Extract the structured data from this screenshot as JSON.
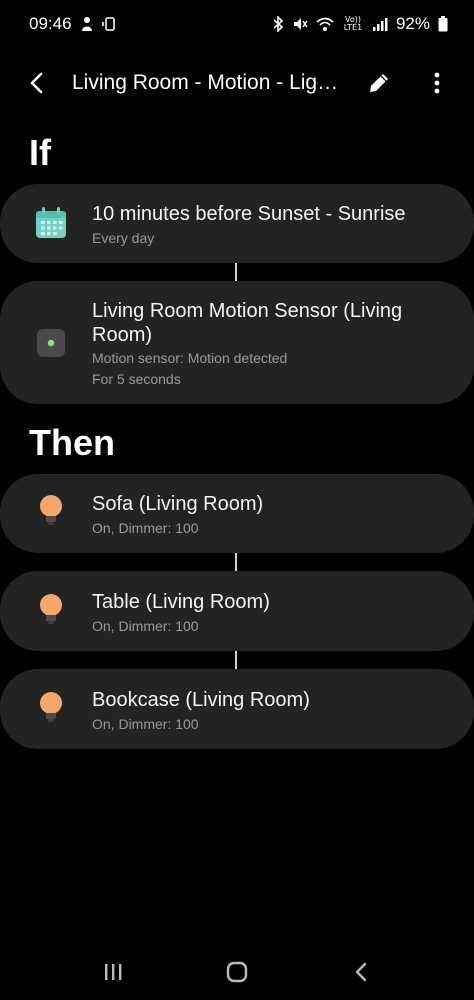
{
  "status_bar": {
    "time": "09:46",
    "volte": "Vo)) LTE1",
    "battery": "92%"
  },
  "app_bar": {
    "title": "Living Room - Motion - Lig…"
  },
  "if_section": {
    "heading": "If",
    "conditions": [
      {
        "icon": "calendar-icon",
        "title": "10 minutes before Sunset - Sunrise",
        "subtitle": "Every day"
      },
      {
        "icon": "motion-sensor-icon",
        "title": "Living Room Motion Sensor (Living Room)",
        "subtitle": "Motion sensor: Motion detected",
        "subtitle2": "For 5 seconds"
      }
    ]
  },
  "then_section": {
    "heading": "Then",
    "actions": [
      {
        "icon": "light-bulb-icon",
        "title": "Sofa (Living Room)",
        "subtitle": "On, Dimmer: 100"
      },
      {
        "icon": "light-bulb-icon",
        "title": "Table (Living Room)",
        "subtitle": "On, Dimmer: 100"
      },
      {
        "icon": "light-bulb-icon",
        "title": "Bookcase (Living Room)",
        "subtitle": "On, Dimmer: 100"
      }
    ]
  },
  "colors": {
    "card_bg": "#232323",
    "calendar_teal": "#6fd3c4",
    "bulb_orange": "#f5a66a",
    "sensor_green": "#8de08a"
  }
}
